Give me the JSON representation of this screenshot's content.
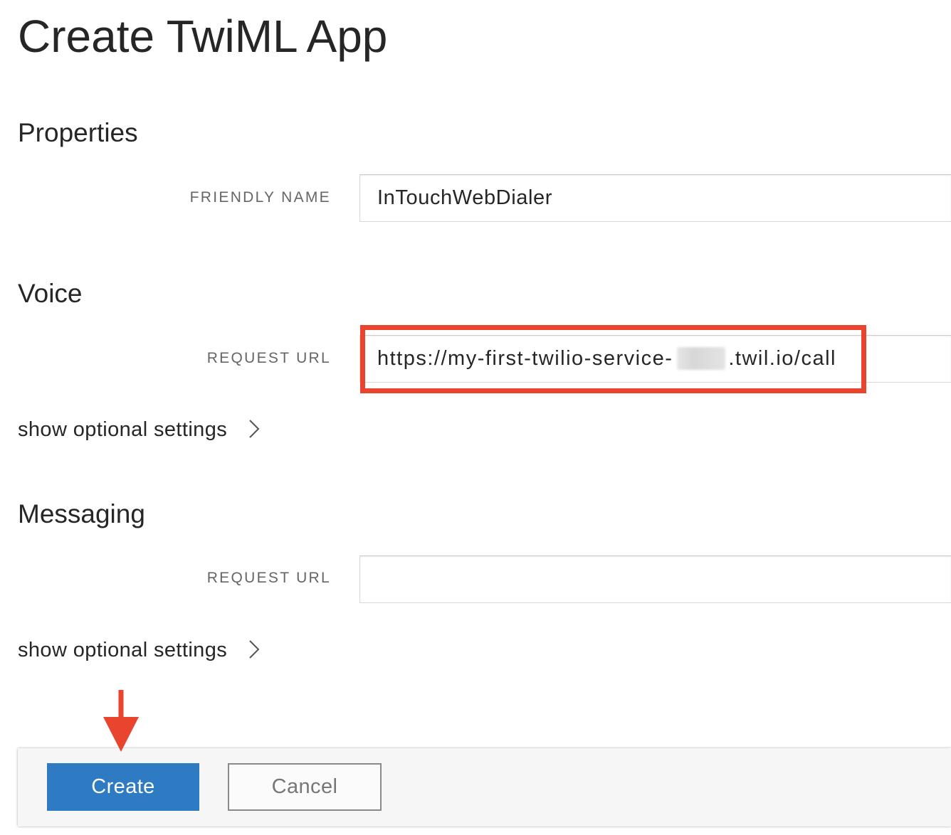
{
  "page": {
    "title": "Create TwiML App"
  },
  "properties": {
    "heading": "Properties",
    "friendly_name": {
      "label": "FRIENDLY NAME",
      "value": "InTouchWebDialer"
    }
  },
  "voice": {
    "heading": "Voice",
    "request_url": {
      "label": "REQUEST URL",
      "value_prefix": "https://my-first-twilio-service-",
      "value_suffix": ".twil.io/call"
    },
    "optional_settings": {
      "label": "show optional settings",
      "icon": "chevron-right-icon"
    }
  },
  "messaging": {
    "heading": "Messaging",
    "request_url": {
      "label": "REQUEST URL",
      "value": ""
    },
    "optional_settings": {
      "label": "show optional settings",
      "icon": "chevron-right-icon"
    }
  },
  "footer": {
    "create_label": "Create",
    "cancel_label": "Cancel"
  },
  "annotations": {
    "arrow_icon": "down-arrow-icon"
  },
  "colors": {
    "primary_button": "#2e7bc4",
    "annotation_red": "#e8442e",
    "text": "#262626",
    "label": "#666666",
    "input_border": "#d9d9d9",
    "footer_bg": "#f6f6f6"
  }
}
